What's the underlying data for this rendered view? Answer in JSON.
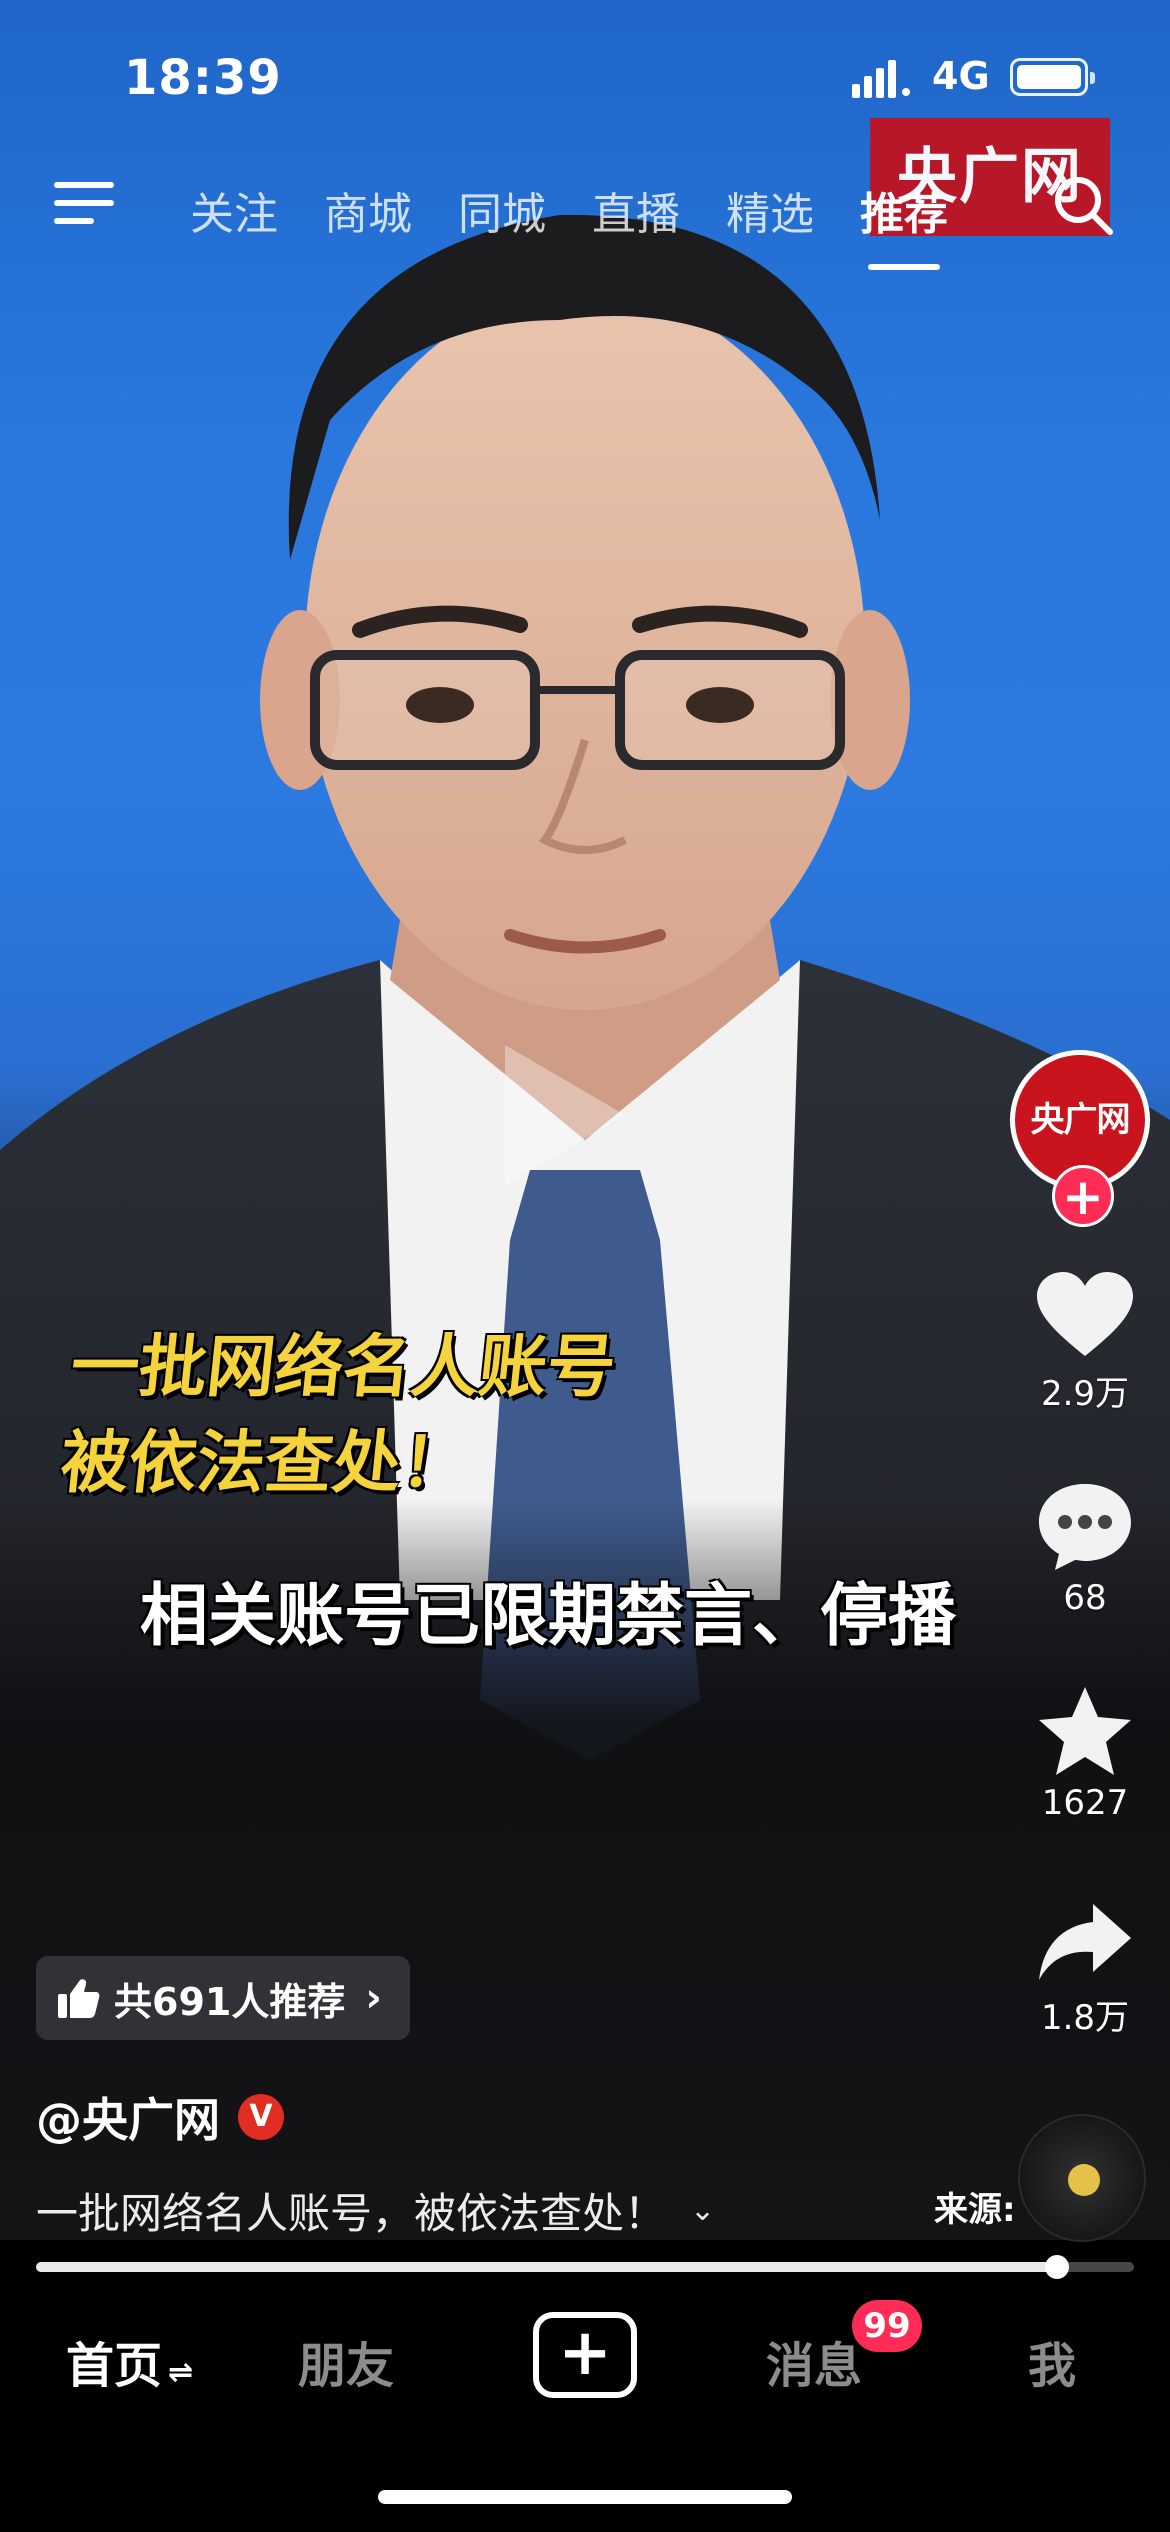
{
  "status_bar": {
    "time": "18:39",
    "network": "4G"
  },
  "top_nav": {
    "tabs": [
      {
        "label": "关注"
      },
      {
        "label": "商城"
      },
      {
        "label": "同城"
      },
      {
        "label": "直播"
      },
      {
        "label": "精选"
      },
      {
        "label": "推荐",
        "active": true
      }
    ],
    "menu_icon": "menu-icon",
    "search_icon": "search-icon"
  },
  "video": {
    "watermark": "央广网",
    "caption_line1": "一批网络名人账号",
    "caption_line2": "被依法查处！",
    "caption_line3": "相关账号已限期禁言、停播"
  },
  "right_rail": {
    "avatar_text": "央广网",
    "follow_label": "+",
    "like_count": "2.9万",
    "comment_count": "68",
    "favorite_count": "1627",
    "share_count": "1.8万"
  },
  "recommend": {
    "label": "共691人推荐",
    "chevron": "›"
  },
  "author": {
    "name": "@央广网",
    "verified_badge": "V"
  },
  "description": {
    "text": "一批网络名人账号，被依法查处！",
    "more_icon": "⌄"
  },
  "source": {
    "label": "来源:"
  },
  "progress": {
    "fraction": 0.93
  },
  "bottom_nav": {
    "home": "首页",
    "home_swap": "⇌",
    "friends": "朋友",
    "create": "+",
    "messages": "消息",
    "messages_badge": "99",
    "me": "我"
  },
  "colors": {
    "accent": "#ff2c55",
    "brand_red": "#c0131f",
    "caption_yellow": "#f4d33c"
  }
}
